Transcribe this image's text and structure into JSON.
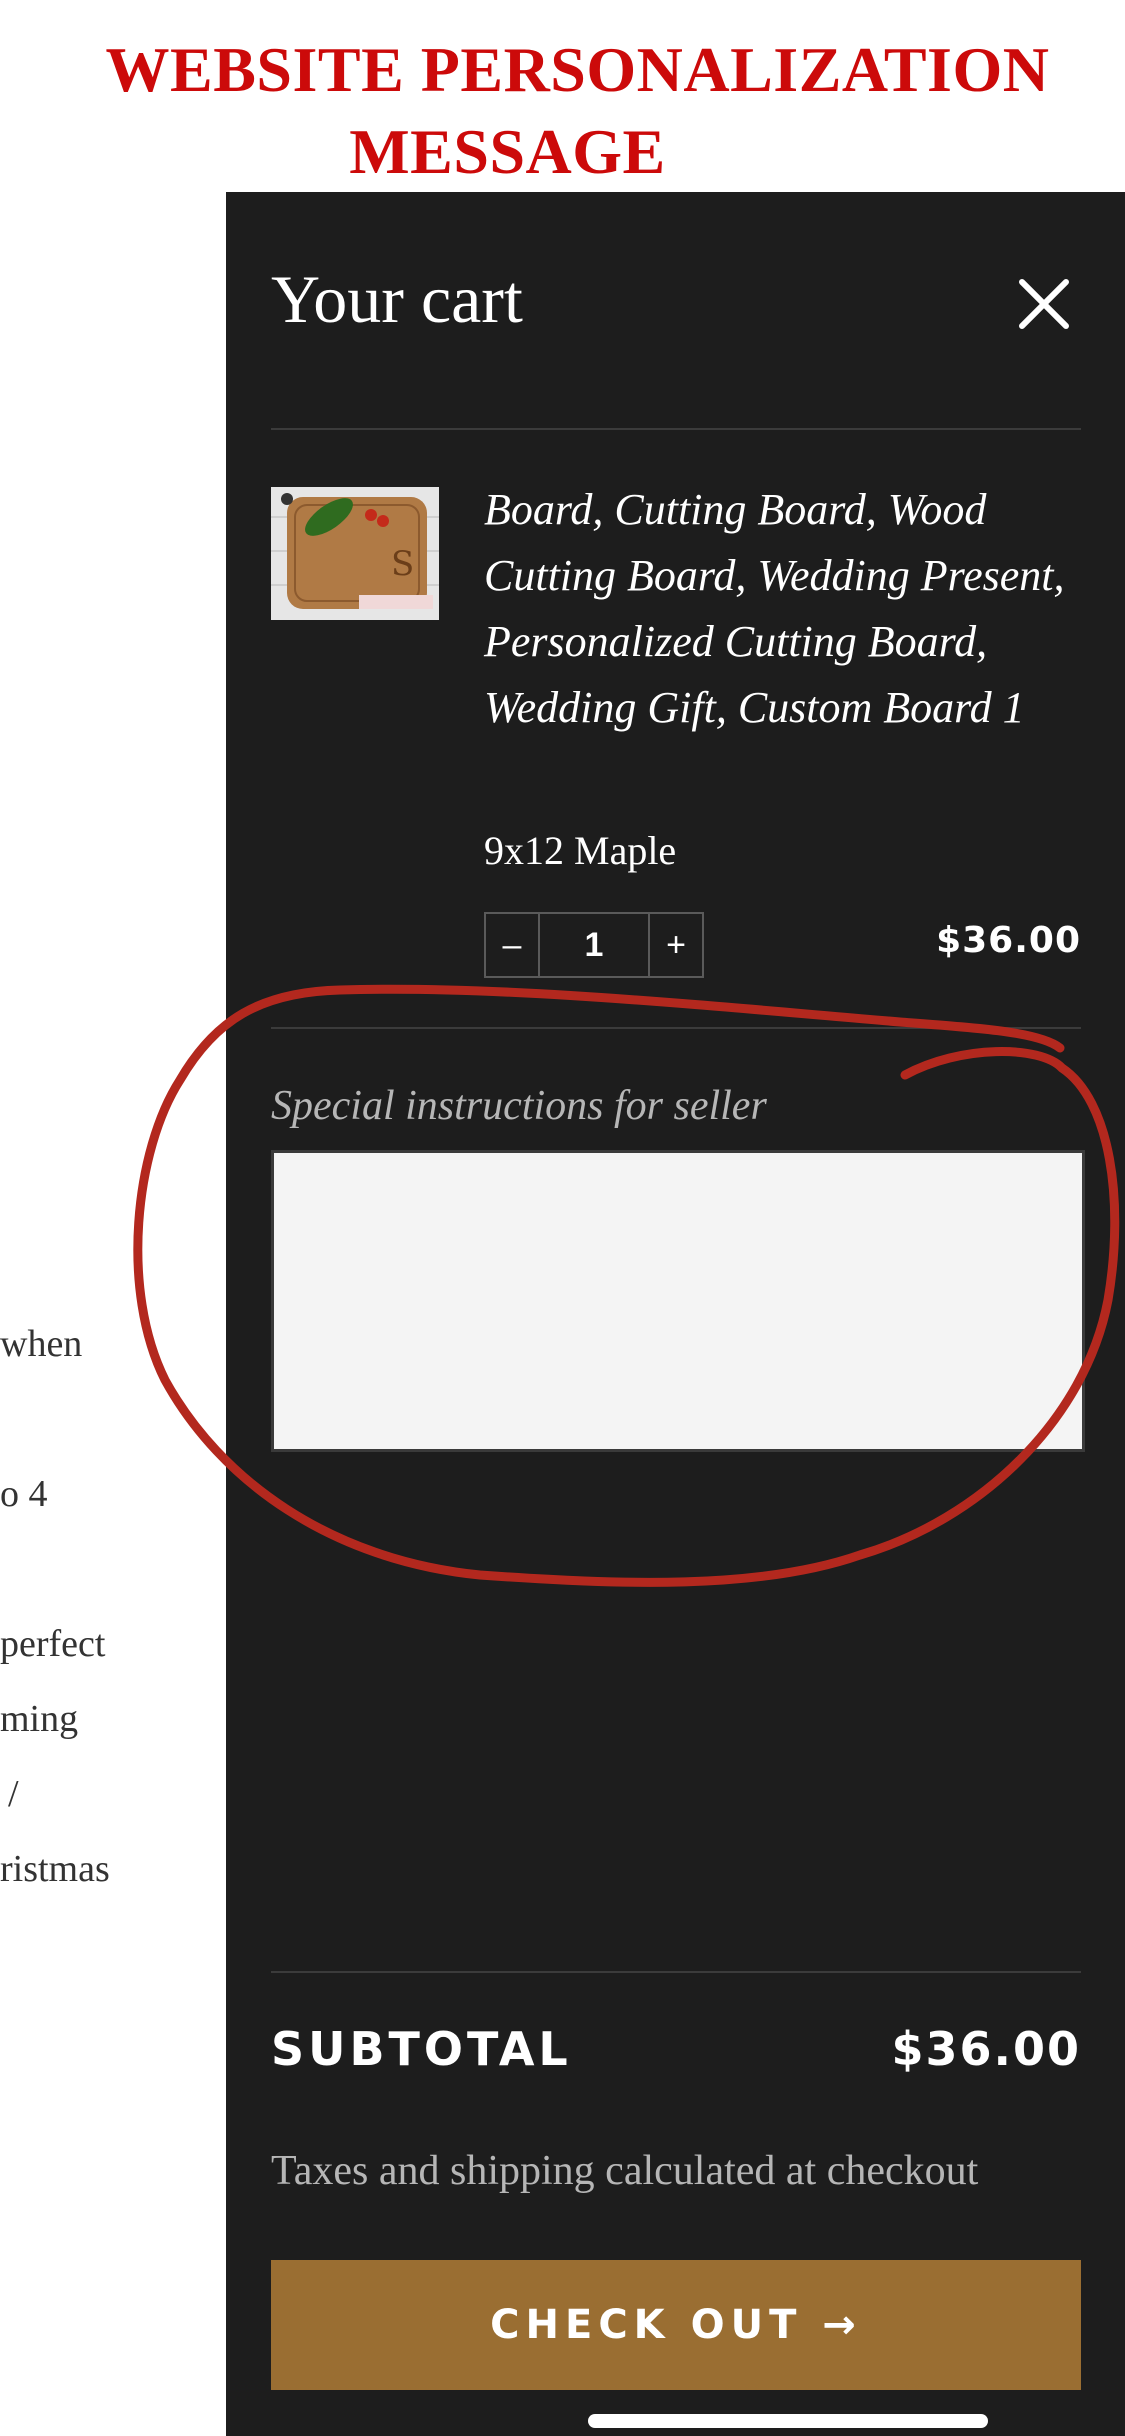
{
  "banner": {
    "line1": "WEBSITE PERSONALIZATION",
    "line2": "MESSAGE",
    "color": "#cc0a0a"
  },
  "background_page": {
    "fragments": [
      "when",
      "o 4",
      "perfect",
      "ming",
      "/",
      "ristmas"
    ]
  },
  "cart": {
    "title": "Your cart",
    "close_icon": "close-icon",
    "item": {
      "title": "Board, Cutting Board, Wood Cutting Board, Wedding Present, Personalized Cutting Board, Wedding Gift, Custom Board 1",
      "variant": "9x12 Maple",
      "quantity": "1",
      "decrement_label": "–",
      "increment_label": "+",
      "price": "$36.00"
    },
    "instructions_label": "Special instructions for seller",
    "instructions_value": "",
    "subtotal_label": "SUBTOTAL",
    "subtotal_value": "$36.00",
    "tax_note": "Taxes and shipping calculated at checkout",
    "checkout_label": "CHECK OUT →"
  },
  "colors": {
    "drawer_bg": "#1d1d1d",
    "checkout_bg": "#9a6e32",
    "annotation": "#b3281e"
  }
}
